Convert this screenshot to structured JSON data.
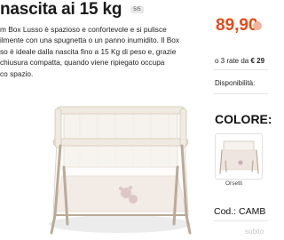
{
  "product": {
    "title": "nascita ai 15 kg",
    "page_badge": "5/5",
    "description_lines": [
      "m Box Lusso è spazioso e confortevole e si pulisce",
      "ilmente con una spugnetta o un panno inumidito. Il Box",
      "so è ideale dalla nascita fino a 15 Kg di peso e, grazie",
      "chiusura compatta, quando viene ripiegato occupa",
      "co spazio."
    ]
  },
  "sidebar": {
    "price": "89,90",
    "installments_prefix": "o 3 rate da ",
    "installments_amount": "€ 29",
    "availability_label": "Disponibilità:",
    "color_heading": "COLORE:",
    "color_option_label": "Orsetti",
    "code_label": "Cod.: CAMB",
    "watermark": "subito"
  },
  "colors": {
    "price": "#e64a19",
    "frame": "#b9ab97",
    "fabric": "#f3efe7"
  },
  "icons": {
    "page_badge": "image-counter",
    "color_swatch": "playpen-thumbnail"
  }
}
